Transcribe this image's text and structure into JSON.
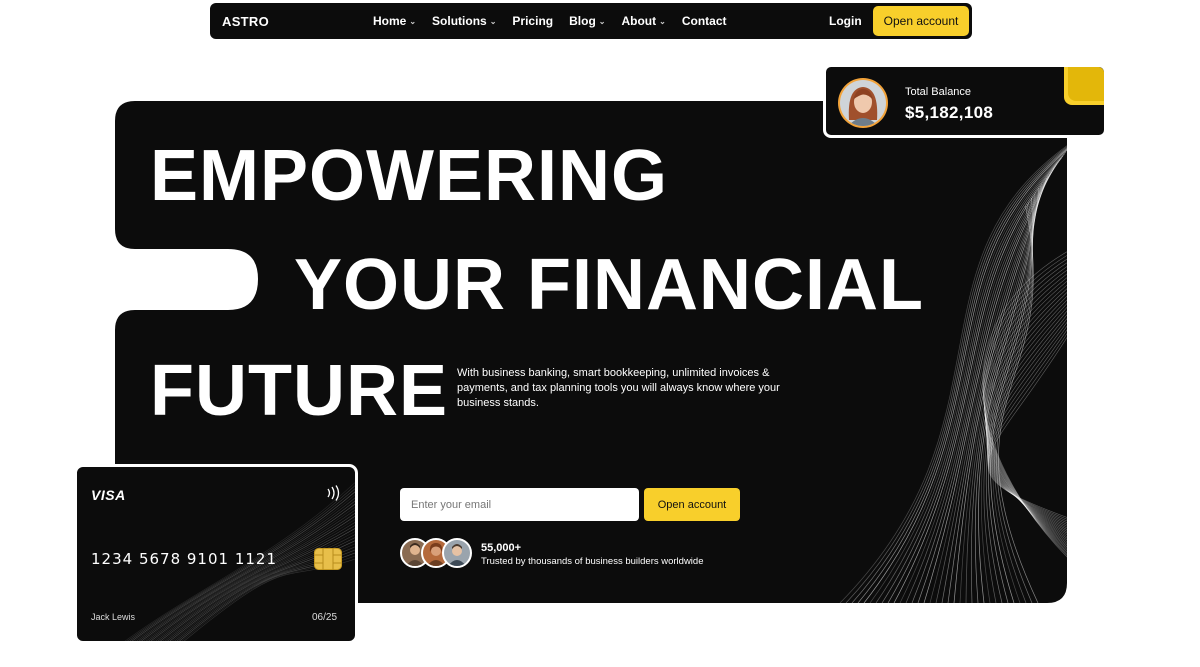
{
  "nav": {
    "brand": "ASTRO",
    "items": [
      {
        "label": "Home",
        "dropdown": true
      },
      {
        "label": "Solutions",
        "dropdown": true
      },
      {
        "label": "Pricing",
        "dropdown": false
      },
      {
        "label": "Blog",
        "dropdown": true
      },
      {
        "label": "About",
        "dropdown": true
      },
      {
        "label": "Contact",
        "dropdown": false
      }
    ],
    "login": "Login",
    "cta": "Open account"
  },
  "hero": {
    "line1": "EMPOWERING",
    "line2": "YOUR FINANCIAL",
    "line3": "FUTURE",
    "description": "With business banking, smart bookkeeping, unlimited invoices & payments, and tax planning tools you will always know where your business stands.",
    "email_placeholder": "Enter your email",
    "cta": "Open account",
    "trust_count": "55,000+",
    "trust_text": "Trusted by thousands of business builders worldwide"
  },
  "balance": {
    "label": "Total Balance",
    "amount": "$5,182,108"
  },
  "card": {
    "brand": "VISA",
    "number": "1234  5678  9101  1121",
    "holder": "Jack Lewis",
    "expiry": "06/25"
  },
  "colors": {
    "accent": "#f8cf2b",
    "dark": "#0c0c0c",
    "background": "#ffffff"
  },
  "icons": {
    "caret": "chevron-down-icon",
    "nfc": "contactless-icon",
    "chip": "card-chip-icon"
  }
}
